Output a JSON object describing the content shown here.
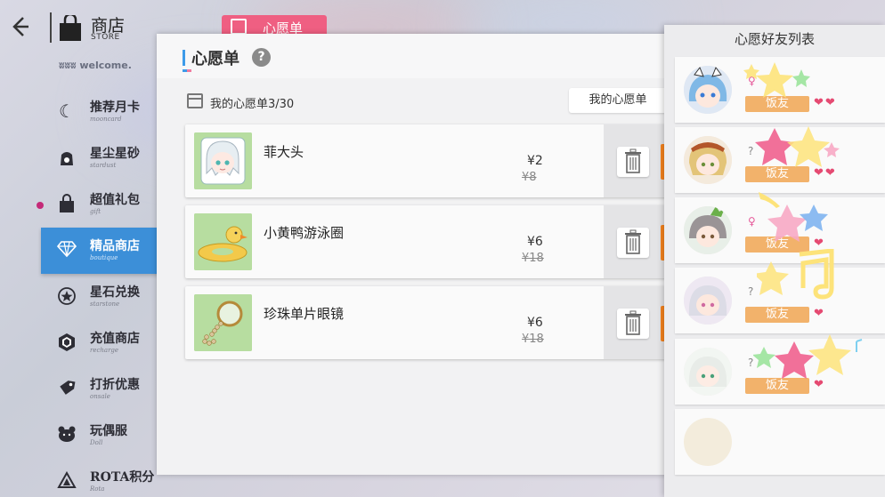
{
  "header": {
    "back_icon": "back-arrow-icon",
    "store_title": "商店",
    "store_sub": "STORE",
    "top_tab_label": "心愿单",
    "welcome": "welcome."
  },
  "sidebar": {
    "items": [
      {
        "label": "推荐月卡",
        "sub": "mooncard",
        "icon": "moon-icon"
      },
      {
        "label": "星尘星砂",
        "sub": "stardust",
        "icon": "stardust-bag-icon"
      },
      {
        "label": "超值礼包",
        "sub": "gift",
        "icon": "gift-bag-icon"
      },
      {
        "label": "精品商店",
        "sub": "boutique",
        "icon": "diamond-icon"
      },
      {
        "label": "星石兑换",
        "sub": "starstone",
        "icon": "star-coin-icon"
      },
      {
        "label": "充值商店",
        "sub": "recharge",
        "icon": "hexagon-gem-icon"
      },
      {
        "label": "打折优惠",
        "sub": "onsale",
        "icon": "price-tag-icon"
      },
      {
        "label": "玩偶服",
        "sub": "Doll",
        "icon": "bear-face-icon"
      },
      {
        "label": "ROTA积分",
        "sub": "Rota",
        "icon": "rota-triangle-icon"
      }
    ],
    "active_index": 3
  },
  "wishlist": {
    "title": "心愿单",
    "count_label": "我的心愿单3/30",
    "my_wishlist_button": "我的心愿单",
    "items": [
      {
        "name": "菲大头",
        "price": "¥2",
        "original_price": "¥8"
      },
      {
        "name": "小黄鸭游泳圈",
        "price": "¥6",
        "original_price": "¥18"
      },
      {
        "name": "珍珠单片眼镜",
        "price": "¥6",
        "original_price": "¥18"
      }
    ]
  },
  "friends": {
    "title": "心愿好友列表",
    "tag": "饭友",
    "list": [
      {
        "gender": "♀",
        "hearts": "❤❤"
      },
      {
        "gender": "?",
        "hearts": "❤❤"
      },
      {
        "gender": "♀",
        "hearts": "❤"
      },
      {
        "gender": "?",
        "hearts": "❤"
      },
      {
        "gender": "?",
        "hearts": "❤"
      }
    ]
  }
}
